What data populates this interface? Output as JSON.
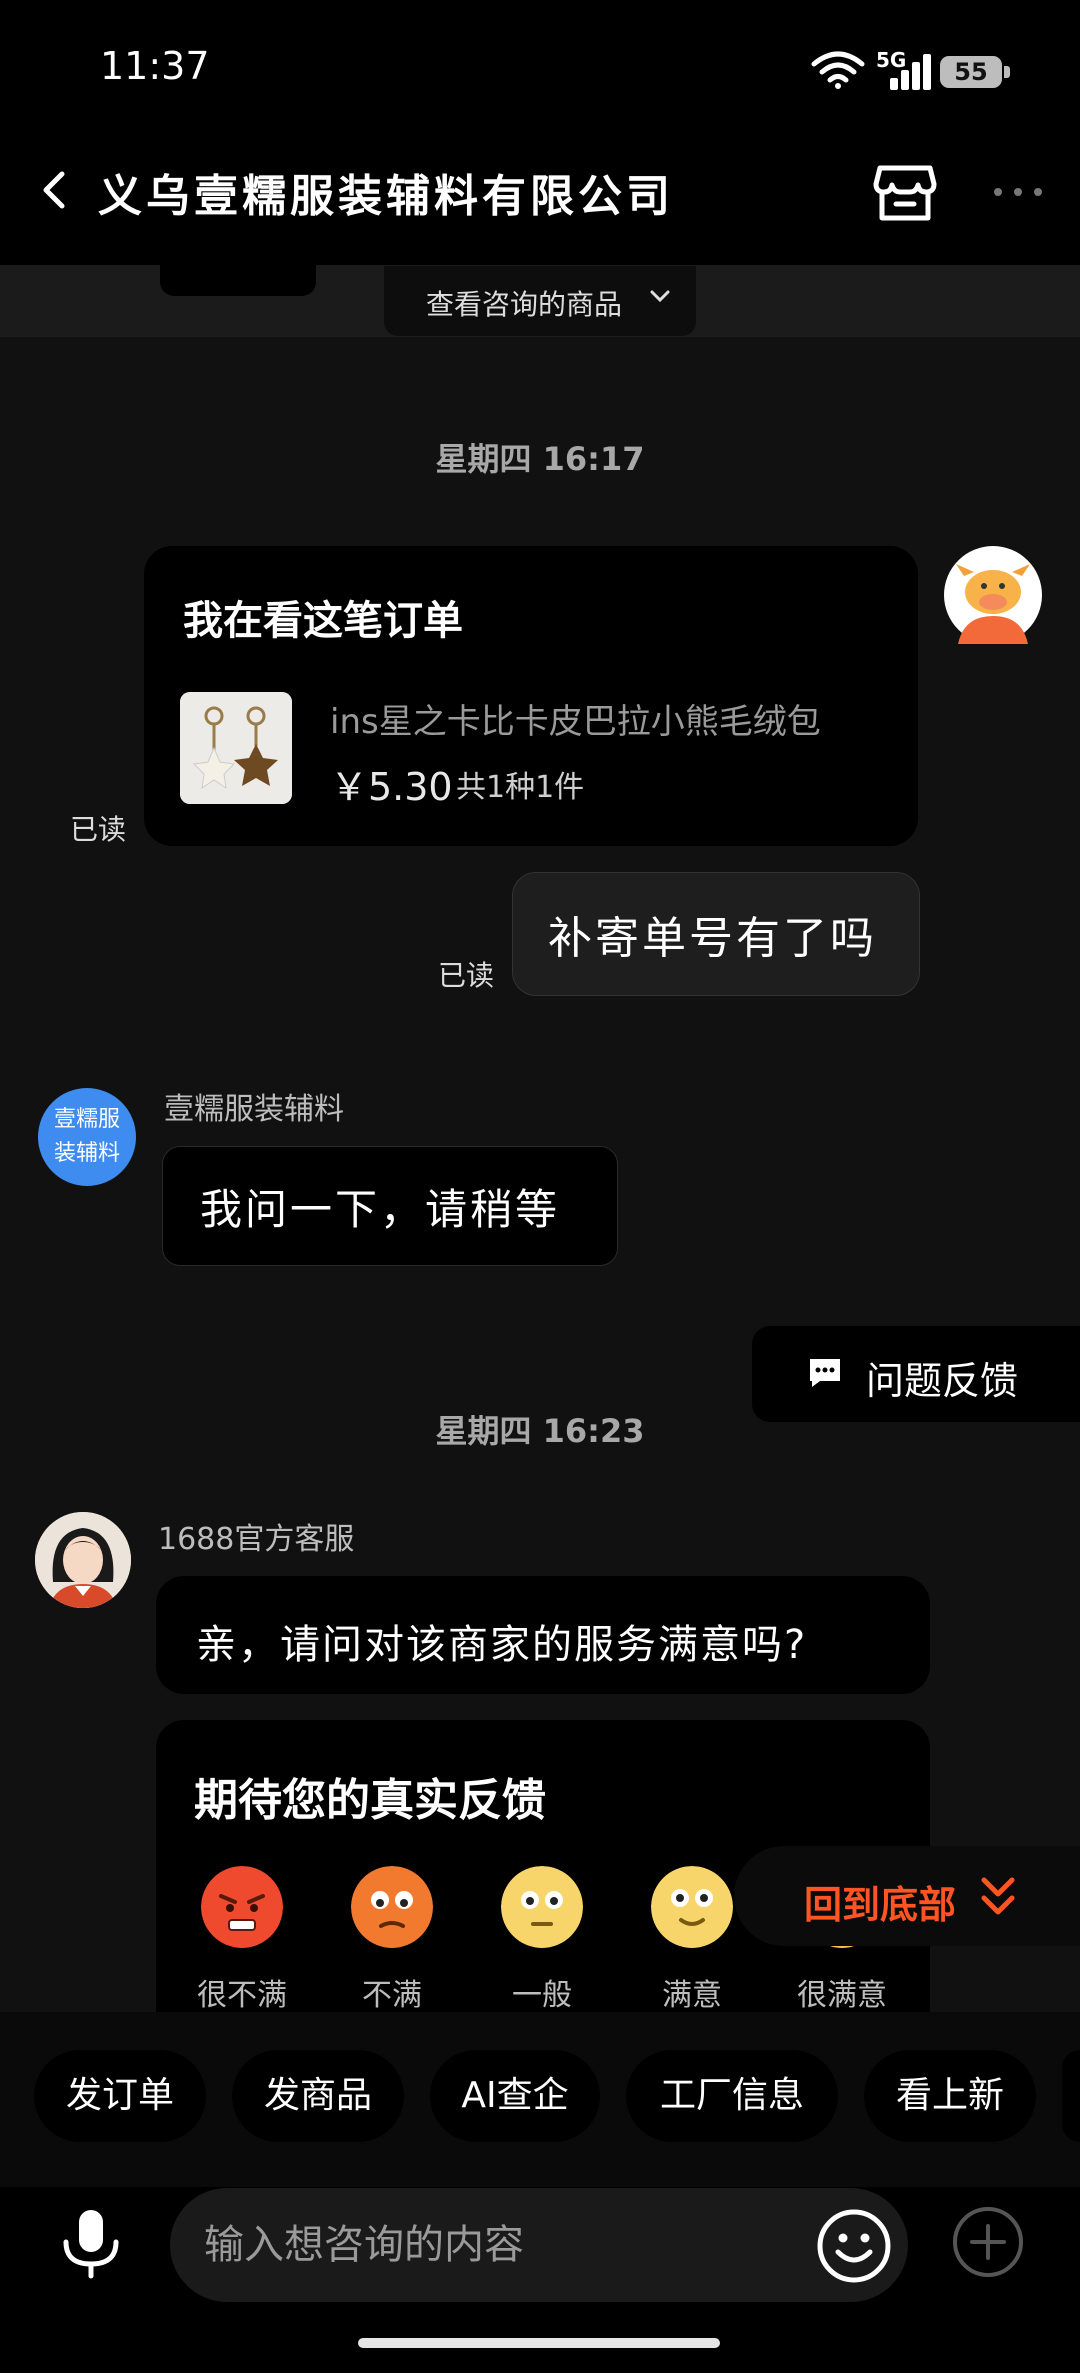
{
  "status_bar": {
    "time": "11:37",
    "network": "5G",
    "battery": "55"
  },
  "header": {
    "title": "义乌壹糯服装辅料有限公司"
  },
  "consult": {
    "label": "查看咨询的商品"
  },
  "messages": {
    "time1": "星期四 16:17",
    "order_card": {
      "title": "我在看这笔订单",
      "product_name": "ins星之卡比卡皮巴拉小熊毛绒包",
      "price": "￥5.30",
      "count": "共1种1件",
      "read": "已读"
    },
    "msg2": {
      "text": "补寄单号有了吗",
      "read": "已读"
    },
    "seller": {
      "avatar_line1": "壹糯服",
      "avatar_line2": "装辅料",
      "name": "壹糯服装辅料",
      "text": "我问一下，请稍等"
    },
    "feedback_button": "问题反馈",
    "time2": "星期四 16:23",
    "cs": {
      "name": "1688官方客服",
      "text": "亲，请问对该商家的服务满意吗?"
    },
    "survey": {
      "title": "期待您的真实反馈",
      "options": [
        "很不满",
        "不满",
        "一般",
        "满意",
        "很满意"
      ]
    }
  },
  "scroll_to_bottom": "回到底部",
  "quick_actions": [
    "发订单",
    "发商品",
    "AI查企",
    "工厂信息",
    "看上新"
  ],
  "input": {
    "placeholder": "输入想咨询的内容"
  },
  "colors": {
    "accent": "#ff5522",
    "seller_avatar": "#3f8cf0",
    "background": "#111111"
  }
}
